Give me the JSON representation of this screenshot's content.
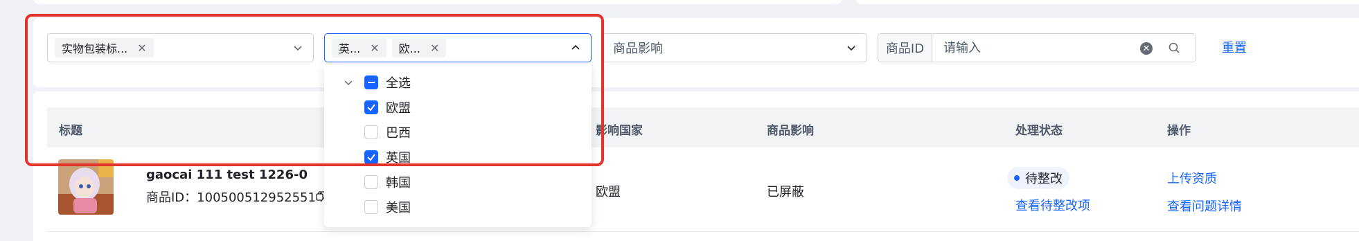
{
  "filters": {
    "category_select": {
      "tags": [
        {
          "label": "实物包装标..."
        }
      ]
    },
    "country_select": {
      "tags": [
        {
          "label": "英..."
        },
        {
          "label": "欧..."
        }
      ]
    },
    "impact_select": {
      "placeholder": "商品影响"
    },
    "product_id_search": {
      "prefix": "商品ID",
      "placeholder": "请输入"
    },
    "reset_label": "重置"
  },
  "country_dropdown": {
    "options": [
      {
        "label": "全选",
        "state": "indeterminate"
      },
      {
        "label": "欧盟",
        "state": "checked"
      },
      {
        "label": "巴西",
        "state": "unchecked"
      },
      {
        "label": "英国",
        "state": "checked"
      },
      {
        "label": "韩国",
        "state": "unchecked"
      },
      {
        "label": "美国",
        "state": "unchecked"
      }
    ]
  },
  "table": {
    "columns": [
      "标题",
      "影响国家",
      "商品影响",
      "处理状态",
      "操作"
    ],
    "rows": [
      {
        "title": "gaocai 111 test 1226-0",
        "product_id": "商品ID：1005005129525514",
        "country": "欧盟",
        "impact": "已屏蔽",
        "status": "待整改",
        "status_link": "查看待整改项",
        "action_1": "上传资质",
        "action_2": "查看问题详情"
      }
    ]
  },
  "colors": {
    "accent": "#1664ff",
    "highlight_frame": "#e5332c"
  }
}
